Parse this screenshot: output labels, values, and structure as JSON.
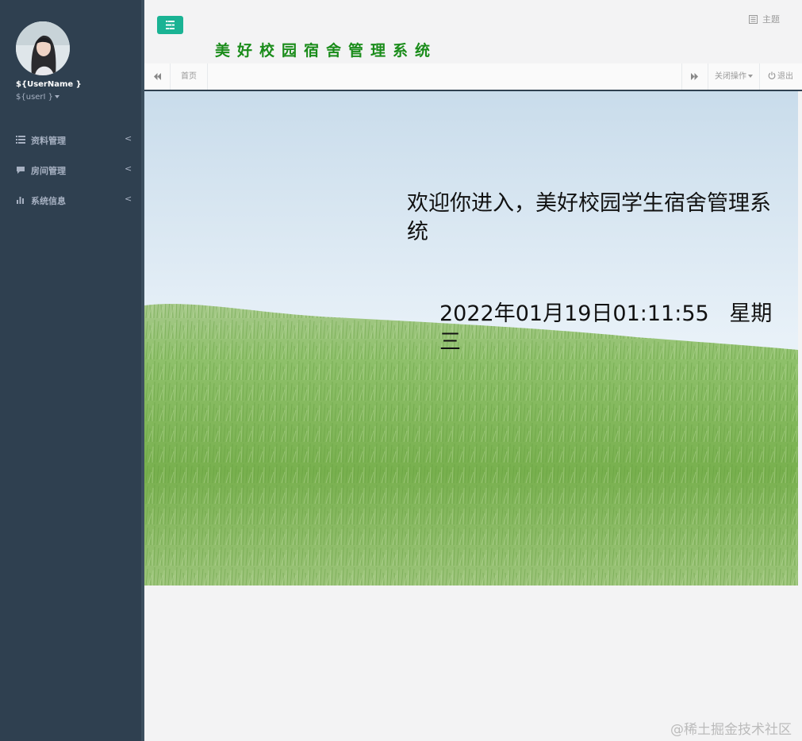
{
  "sidebar": {
    "user_name": "${UserName }",
    "user_role": "${userI }",
    "items": [
      {
        "label": "资料管理",
        "arrow": "<",
        "icon": "list-icon"
      },
      {
        "label": "房间管理",
        "arrow": "<",
        "icon": "comment-icon"
      },
      {
        "label": "系统信息",
        "arrow": "<",
        "icon": "bar-chart-icon"
      }
    ]
  },
  "header": {
    "title": "美好校园宿舍管理系统",
    "theme_label": "主题",
    "toggle_icon": "menu-toggle-icon",
    "accent_color": "#1ab394",
    "title_color": "#1a8c1a"
  },
  "tabs": {
    "home_label": "首页",
    "close_ops_label": "关闭操作",
    "logout_label": "退出"
  },
  "content": {
    "welcome": "欢迎你进入，美好校园学生宿舍管理系统",
    "datetime": "2022年01月19日01:11:55   星期三"
  },
  "watermark": "@稀土掘金技术社区"
}
